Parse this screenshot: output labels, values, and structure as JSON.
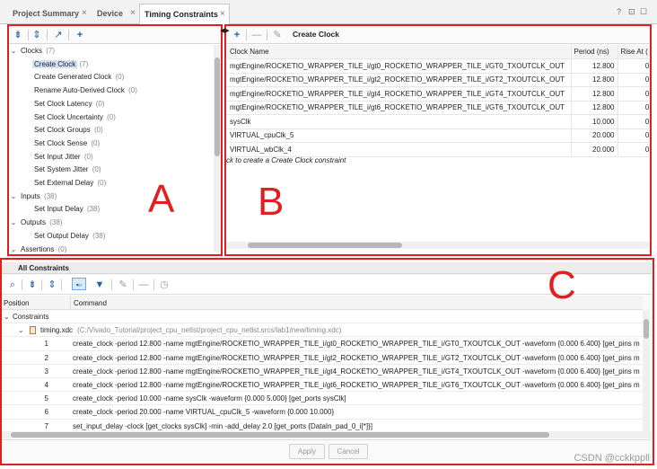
{
  "tabs": [
    {
      "label": "Project Summary",
      "close": "×"
    },
    {
      "label": "Device",
      "close": "×"
    },
    {
      "label": "Timing Constraints",
      "close": "×"
    }
  ],
  "window_controls": {
    "help": "?",
    "restore": "⊡",
    "maximize": "☐"
  },
  "pane_a": {
    "label": "A",
    "tree": [
      {
        "text": "Clocks",
        "count": "(7)",
        "level": 0,
        "expanded": true
      },
      {
        "text": "Create Clock",
        "count": "(7)",
        "level": 1,
        "selected": true
      },
      {
        "text": "Create Generated Clock",
        "count": "(0)",
        "level": 1
      },
      {
        "text": "Rename Auto-Derived Clock",
        "count": "(0)",
        "level": 1
      },
      {
        "text": "Set Clock Latency",
        "count": "(0)",
        "level": 1
      },
      {
        "text": "Set Clock Uncertainty",
        "count": "(0)",
        "level": 1
      },
      {
        "text": "Set Clock Groups",
        "count": "(0)",
        "level": 1
      },
      {
        "text": "Set Clock Sense",
        "count": "(0)",
        "level": 1
      },
      {
        "text": "Set Input Jitter",
        "count": "(0)",
        "level": 1
      },
      {
        "text": "Set System Jitter",
        "count": "(0)",
        "level": 1
      },
      {
        "text": "Set External Delay",
        "count": "(0)",
        "level": 1
      },
      {
        "text": "Inputs",
        "count": "(38)",
        "level": 0,
        "expanded": true
      },
      {
        "text": "Set Input Delay",
        "count": "(38)",
        "level": 1
      },
      {
        "text": "Outputs",
        "count": "(38)",
        "level": 0,
        "expanded": true
      },
      {
        "text": "Set Output Delay",
        "count": "(38)",
        "level": 1
      },
      {
        "text": "Assertions",
        "count": "(0)",
        "level": 0,
        "expanded": true
      }
    ]
  },
  "pane_b": {
    "label": "B",
    "toolbar_title": "Create Clock",
    "columns": [
      "Clock Name",
      "Period (ns)",
      "Rise At ("
    ],
    "rows": [
      {
        "name": "mgtEngine/ROCKETIO_WRAPPER_TILE_i/gt0_ROCKETIO_WRAPPER_TILE_i/GT0_TXOUTCLK_OUT",
        "period": "12.800",
        "rise": "0."
      },
      {
        "name": "mgtEngine/ROCKETIO_WRAPPER_TILE_i/gt2_ROCKETIO_WRAPPER_TILE_i/GT2_TXOUTCLK_OUT",
        "period": "12.800",
        "rise": "0."
      },
      {
        "name": "mgtEngine/ROCKETIO_WRAPPER_TILE_i/gt4_ROCKETIO_WRAPPER_TILE_i/GT4_TXOUTCLK_OUT",
        "period": "12.800",
        "rise": "0."
      },
      {
        "name": "mgtEngine/ROCKETIO_WRAPPER_TILE_i/gt6_ROCKETIO_WRAPPER_TILE_i/GT6_TXOUTCLK_OUT",
        "period": "12.800",
        "rise": "0."
      },
      {
        "name": "sysClk",
        "period": "10.000",
        "rise": "0."
      },
      {
        "name": "VIRTUAL_cpuClk_5",
        "period": "20.000",
        "rise": "0."
      },
      {
        "name": "VIRTUAL_wbClk_4",
        "period": "20.000",
        "rise": "0."
      }
    ],
    "hint": "ck to create a Create Clock constraint"
  },
  "pane_c": {
    "label": "C",
    "title": "All Constraints",
    "col_position": "Position",
    "col_command": "Command",
    "group": "Constraints",
    "file_name": "timing.xdc",
    "file_path": "(C:/Vivado_Tutorial/project_cpu_netlst/project_cpu_netlst.srcs/lab1/new/timing.xdc)",
    "rows": [
      {
        "pos": "1",
        "cmd": "create_clock -period 12.800 -name mgtEngine/ROCKETIO_WRAPPER_TILE_i/gt0_ROCKETIO_WRAPPER_TILE_i/GT0_TXOUTCLK_OUT -waveform {0.000 6.400} [get_pins m"
      },
      {
        "pos": "2",
        "cmd": "create_clock -period 12.800 -name mgtEngine/ROCKETIO_WRAPPER_TILE_i/gt2_ROCKETIO_WRAPPER_TILE_i/GT2_TXOUTCLK_OUT -waveform {0.000 6.400} [get_pins m"
      },
      {
        "pos": "3",
        "cmd": "create_clock -period 12.800 -name mgtEngine/ROCKETIO_WRAPPER_TILE_i/gt4_ROCKETIO_WRAPPER_TILE_i/GT4_TXOUTCLK_OUT -waveform {0.000 6.400} [get_pins m"
      },
      {
        "pos": "4",
        "cmd": "create_clock -period 12.800 -name mgtEngine/ROCKETIO_WRAPPER_TILE_i/gt6_ROCKETIO_WRAPPER_TILE_i/GT6_TXOUTCLK_OUT -waveform {0.000 6.400} [get_pins m"
      },
      {
        "pos": "5",
        "cmd": "create_clock -period 10.000 -name sysClk -waveform {0.000 5.000} [get_ports sysClk]"
      },
      {
        "pos": "6",
        "cmd": "create_clock -period 20.000 -name VIRTUAL_cpuClk_5 -waveform {0.000 10.000}"
      },
      {
        "pos": "7",
        "cmd": "set_input_delay -clock [get_clocks sysClk] -min -add_delay 2.0 [get_ports {DataIn_pad_0_i[*]}]"
      }
    ],
    "apply": "Apply",
    "cancel": "Cancel"
  },
  "watermark": "CSDN @cckkppll",
  "colors": {
    "annotation": "#e02020",
    "accent": "#1f5fa8",
    "selection": "#cfe1f7"
  }
}
